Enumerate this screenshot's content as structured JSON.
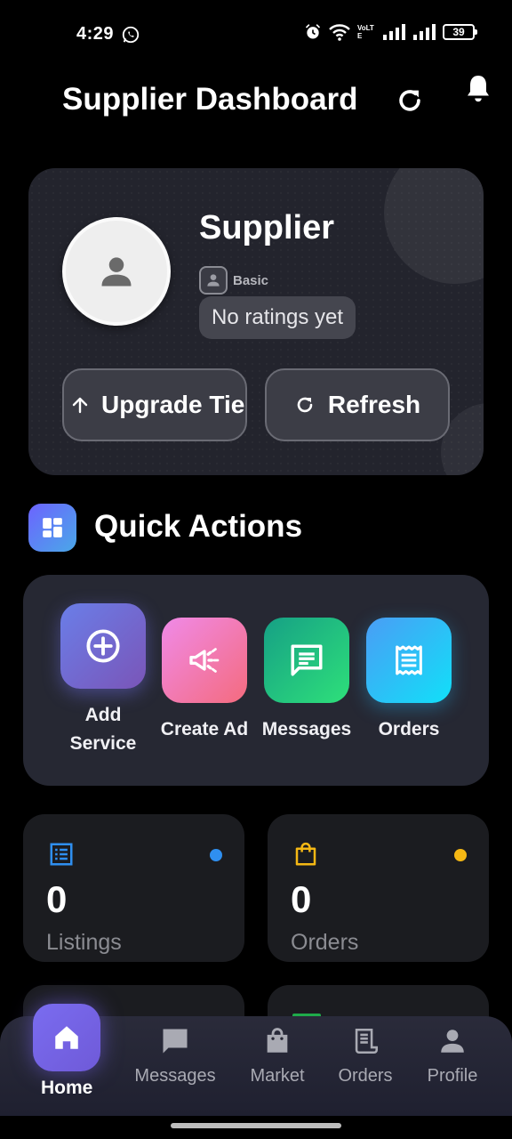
{
  "status_bar": {
    "time": "4:29",
    "battery": "39",
    "network": "VoLTE"
  },
  "app_bar": {
    "title": "Supplier Dashboard"
  },
  "profile": {
    "name": "Supplier",
    "tier": "Basic",
    "ratings": "No ratings yet",
    "upgrade_label": "Upgrade Tier",
    "refresh_label": "Refresh"
  },
  "quick_actions": {
    "title": "Quick Actions",
    "items": [
      {
        "label": "Add Service",
        "icon": "add-circle-icon",
        "color_start": "#6a7ee8",
        "color_end": "#7a55b8"
      },
      {
        "label": "Create Ad",
        "icon": "megaphone-icon",
        "color_start": "#f08ae8",
        "color_end": "#f46b7e"
      },
      {
        "label": "Messages",
        "icon": "message-icon",
        "color_start": "#16a085",
        "color_end": "#2ee07a"
      },
      {
        "label": "Orders",
        "icon": "receipt-icon",
        "color_start": "#4a9df5",
        "color_end": "#11e0f8"
      }
    ]
  },
  "stats": [
    {
      "value": "0",
      "label": "Listings",
      "icon": "list-icon",
      "dot_color": "#2f8ff0",
      "icon_color": "#2f8ff0"
    },
    {
      "value": "0",
      "label": "Orders",
      "icon": "shopping-bag-icon",
      "dot_color": "#f5b814",
      "icon_color": "#f5b814"
    }
  ],
  "bottom_nav": {
    "items": [
      {
        "label": "Home",
        "icon": "home-icon",
        "active": true
      },
      {
        "label": "Messages",
        "icon": "chat-icon",
        "active": false
      },
      {
        "label": "Market",
        "icon": "shopping-bag-icon",
        "active": false
      },
      {
        "label": "Orders",
        "icon": "receipt-icon",
        "active": false
      },
      {
        "label": "Profile",
        "icon": "person-icon",
        "active": false
      }
    ]
  },
  "colors": {
    "background": "#000000",
    "card": "#23242d",
    "panel": "#262833",
    "accent": "#7a6cf0"
  }
}
